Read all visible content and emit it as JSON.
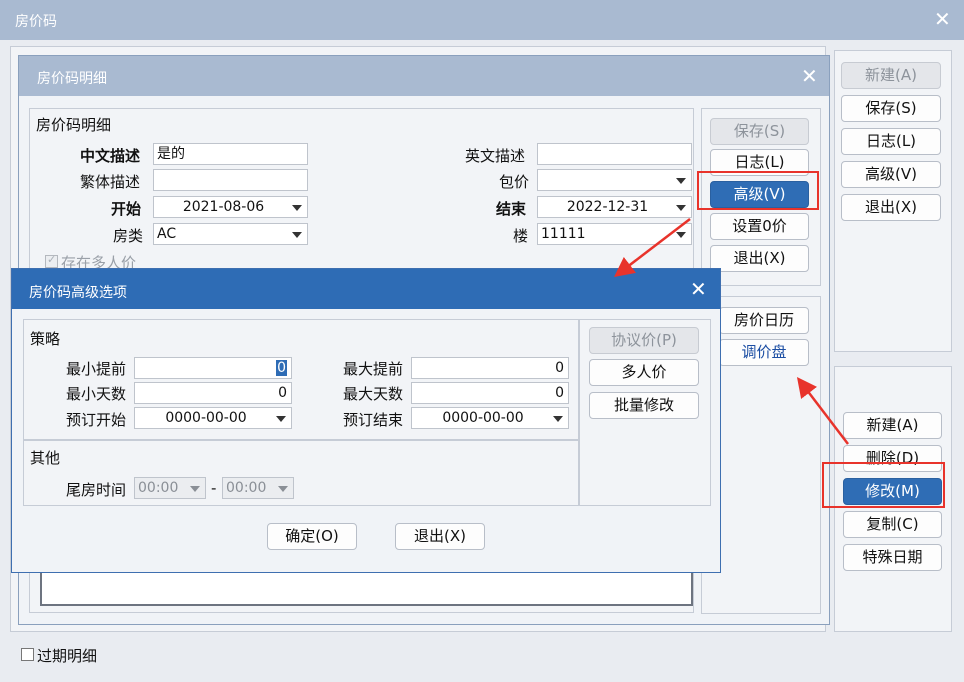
{
  "main": {
    "title": "房价码",
    "close": "✕",
    "right_top_buttons": [
      "新建(A)",
      "保存(S)",
      "日志(L)",
      "高级(V)",
      "退出(X)"
    ],
    "right_bottom_buttons": [
      "新建(A)",
      "删除(D)",
      "修改(M)",
      "复制(C)",
      "特殊日期"
    ],
    "expired_label": "过期明细"
  },
  "detail": {
    "title": "房价码明细",
    "close": "✕",
    "section": "房价码明细",
    "labels": {
      "cn_desc": "中文描述",
      "en_desc": "英文描述",
      "trad_desc": "繁体描述",
      "package": "包价",
      "start": "开始",
      "end": "结束",
      "room_type": "房类",
      "floor": "楼",
      "multi_price": "存在多人价"
    },
    "values": {
      "cn_desc": "是的",
      "en_desc": "",
      "trad_desc": "",
      "package": "",
      "start": "2021-08-06",
      "end": "2022-12-31",
      "room_type": "AC",
      "floor": "11111"
    },
    "buttons": [
      "保存(S)",
      "日志(L)",
      "高级(V)",
      "设置0价",
      "退出(X)"
    ],
    "side_buttons": [
      "房价日历",
      "调价盘"
    ]
  },
  "advanced": {
    "title": "房价码高级选项",
    "close": "✕",
    "strategy": "策略",
    "other": "其他",
    "labels": {
      "min_advance": "最小提前",
      "max_advance": "最大提前",
      "min_days": "最小天数",
      "max_days": "最大天数",
      "book_start": "预订开始",
      "book_end": "结束",
      "book_end_full": "预订结束",
      "tail_time": "尾房时间"
    },
    "values": {
      "min_advance": "0",
      "max_advance": "0",
      "min_days": "0",
      "max_days": "0",
      "book_start": "0000-00-00",
      "book_end": "0000-00-00",
      "tail_from": "00:00",
      "tail_to": "00:00",
      "dash": "-"
    },
    "side_buttons": [
      "协议价(P)",
      "多人价",
      "批量修改"
    ],
    "ok": "确定(O)",
    "exit": "退出(X)"
  }
}
